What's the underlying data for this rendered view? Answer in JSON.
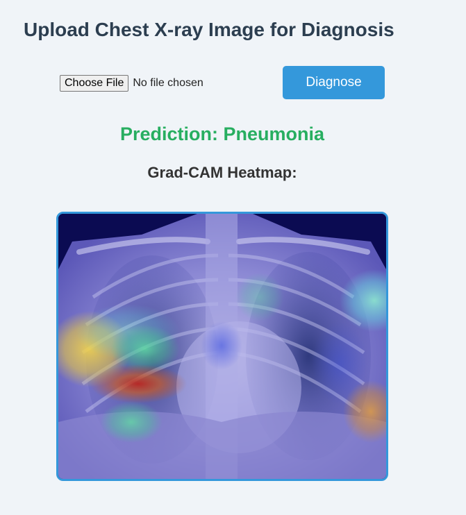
{
  "header": {
    "title": "Upload Chest X-ray Image for Diagnosis"
  },
  "upload": {
    "choose_file_label": "Choose File",
    "no_file_text": "No file chosen",
    "diagnose_label": "Diagnose"
  },
  "result": {
    "prediction_text": "Prediction: Pneumonia",
    "heatmap_heading": "Grad-CAM Heatmap:"
  },
  "colors": {
    "background": "#f0f4f8",
    "title": "#2c3e50",
    "accent": "#3498db",
    "prediction": "#27ae60",
    "heading": "#333333"
  }
}
